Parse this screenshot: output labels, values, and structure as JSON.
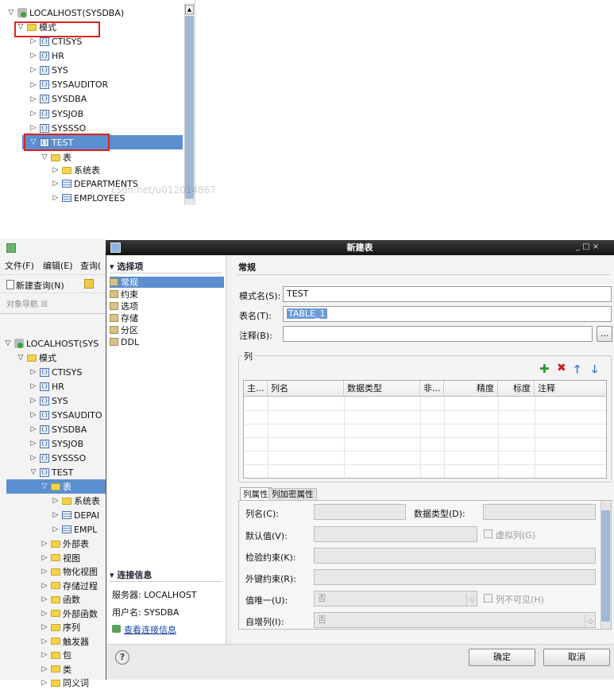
{
  "top_tree": {
    "root": "LOCALHOST(SYSDBA)",
    "schema_folder": "模式",
    "schemas": [
      "CTISYS",
      "HR",
      "SYS",
      "SYSAUDITOR",
      "SYSDBA",
      "SYSJOB",
      "SYSSSO"
    ],
    "selected_schema": "TEST",
    "table_folder": "表",
    "children": [
      "系统表",
      "DEPARTMENTS",
      "EMPLOYEES"
    ],
    "watermark": "csdn.net/u012014867"
  },
  "left_panel": {
    "menus": [
      "文件(F)",
      "编辑(E)",
      "查询("
    ],
    "new_query": "新建查询(N)",
    "nav_title": "对象导航 ☒",
    "root": "LOCALHOST(SYS",
    "schema_folder": "模式",
    "schemas": [
      "CTISYS",
      "HR",
      "SYS",
      "SYSAUDITO",
      "SYSDBA",
      "SYSJOB",
      "SYSSSO"
    ],
    "test": "TEST",
    "table_folder": "表",
    "tables": [
      "系统表",
      "DEPAI",
      "EMPL"
    ],
    "folders": [
      "外部表",
      "视图",
      "物化视图",
      "存储过程",
      "函数",
      "外部函数",
      "序列",
      "触发器",
      "包",
      "类",
      "同义词"
    ]
  },
  "dialog": {
    "title": "新建表",
    "nav_header": "选择项",
    "nav_items": [
      "常规",
      "约束",
      "选项",
      "存储",
      "分区",
      "DDL"
    ],
    "conn_header": "连接信息",
    "server": "服务器: LOCALHOST",
    "user": "用户名: SYSDBA",
    "view_conn": "查看连接信息",
    "section": "常规",
    "schema_label": "模式名(S):",
    "schema_value": "TEST",
    "table_label": "表名(T):",
    "table_value": "TABLE_1",
    "comment_label": "注释(B):",
    "comment_btn": "...",
    "columns_group": "列",
    "grid_headers": [
      "主...",
      "列名",
      "数据类型",
      "非...",
      "精度",
      "标度",
      "注释"
    ],
    "tabs": [
      "列属性",
      "列加密属性"
    ],
    "col_name": "列名(C):",
    "data_type": "数据类型(D):",
    "default_value": "默认值(V):",
    "virtual_col": "虚拟列(G)",
    "check": "检验约束(K):",
    "foreign": "外键约束(R):",
    "unique": "值唯一(U):",
    "unique_val": "否",
    "invisible": "列不可见(H)",
    "autoinc": "自增列(I):",
    "autoinc_val": "否",
    "help": "?",
    "ok": "确定",
    "cancel": "取消",
    "window_controls": "_ □ ×"
  },
  "colors": {
    "selection": "#5b8fcf",
    "highlight_box": "#e02020",
    "add": "#2e9b2e",
    "delete": "#d02020",
    "arrow": "#2f7ad0"
  }
}
